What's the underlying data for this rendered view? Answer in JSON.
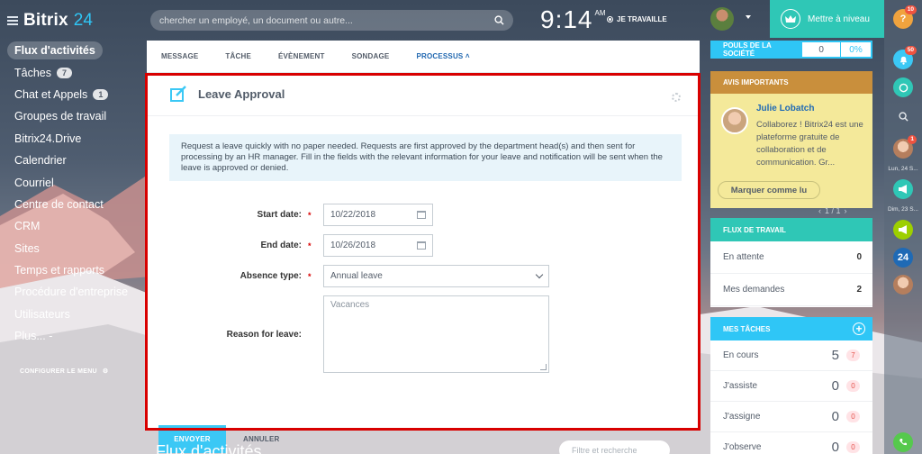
{
  "app": {
    "logo_text": "Bitrix",
    "logo_num": "24"
  },
  "header": {
    "search_placeholder": "chercher un employé, un document ou autre...",
    "time": "9:14",
    "ampm": "AM",
    "work_status": "JE TRAVAILLE",
    "upgrade_label": "Mettre à niveau"
  },
  "sidebar": {
    "items": [
      {
        "label": "Flux d'activités",
        "count": ""
      },
      {
        "label": "Tâches",
        "count": "7"
      },
      {
        "label": "Chat et Appels",
        "count": "1"
      },
      {
        "label": "Groupes de travail",
        "count": ""
      },
      {
        "label": "Bitrix24.Drive",
        "count": ""
      },
      {
        "label": "Calendrier",
        "count": ""
      },
      {
        "label": "Courriel",
        "count": ""
      },
      {
        "label": "Centre de contact",
        "count": ""
      },
      {
        "label": "CRM",
        "count": ""
      },
      {
        "label": "Sites",
        "count": ""
      },
      {
        "label": "Temps et rapports",
        "count": ""
      },
      {
        "label": "Procédure d'entreprise",
        "count": ""
      },
      {
        "label": "Utilisateurs",
        "count": ""
      },
      {
        "label": "Plus... -",
        "count": ""
      }
    ],
    "configure_label": "CONFIGURER LE MENU"
  },
  "post_tabs": [
    {
      "label": "MESSAGE"
    },
    {
      "label": "TÂCHE"
    },
    {
      "label": "ÉVÈNEMENT"
    },
    {
      "label": "SONDAGE"
    },
    {
      "label": "PROCESSUS ˄"
    }
  ],
  "form": {
    "title": "Leave Approval",
    "info": "Request a leave quickly with no paper needed. Requests are first approved by the department head(s) and then sent for processing by an HR manager. Fill in the fields with the relevant information for your leave and notification will be sent when the leave is approved or denied.",
    "start_label": "Start date:",
    "start_value": "10/22/2018",
    "end_label": "End date:",
    "end_value": "10/26/2018",
    "absence_label": "Absence type:",
    "absence_value": "Annual leave",
    "reason_label": "Reason for leave:",
    "reason_placeholder": "Vacances",
    "required_mark": "*",
    "send_label": "ENVOYER",
    "cancel_label": "ANNULER"
  },
  "feed": {
    "title": "Flux d'activités",
    "filter_placeholder": "Filtre et recherche"
  },
  "right": {
    "poll_label": "POULS DE LA SOCIÉTÉ",
    "poll_value": "0",
    "poll_percent": "0%",
    "announce_head": "AVIS IMPORTANTS",
    "announce_author": "Julie Lobatch",
    "announce_text": "Collaborez ! Bitrix24 est une plateforme gratuite de collaboration et de communication. Gr...",
    "announce_button": "Marquer comme lu",
    "pager": "1 / 1",
    "workflow_head": "FLUX DE TRAVAIL",
    "workflow_rows": [
      {
        "label": "En attente",
        "value": "0"
      },
      {
        "label": "Mes demandes",
        "value": "2"
      }
    ],
    "tasks_head": "MES TÂCHES",
    "tasks_rows": [
      {
        "label": "En cours",
        "value": "5",
        "badge": "7"
      },
      {
        "label": "J'assiste",
        "value": "0",
        "badge": "0"
      },
      {
        "label": "J'assigne",
        "value": "0",
        "badge": "0"
      },
      {
        "label": "J'observe",
        "value": "0",
        "badge": "0"
      }
    ]
  },
  "far_bar": {
    "help_badge": "10",
    "bell_badge": "50",
    "chat_badge": "1",
    "date1": "Lun, 24 S...",
    "date2": "Dim, 23 S...",
    "b24": "24",
    "help_icon": "?"
  },
  "colors": {
    "accent": "#2fc6f6",
    "teal": "#2fc7b6",
    "announce_bg": "#f4e99a",
    "announce_head": "#c98f3c",
    "highlight_outline": "#d80000"
  }
}
